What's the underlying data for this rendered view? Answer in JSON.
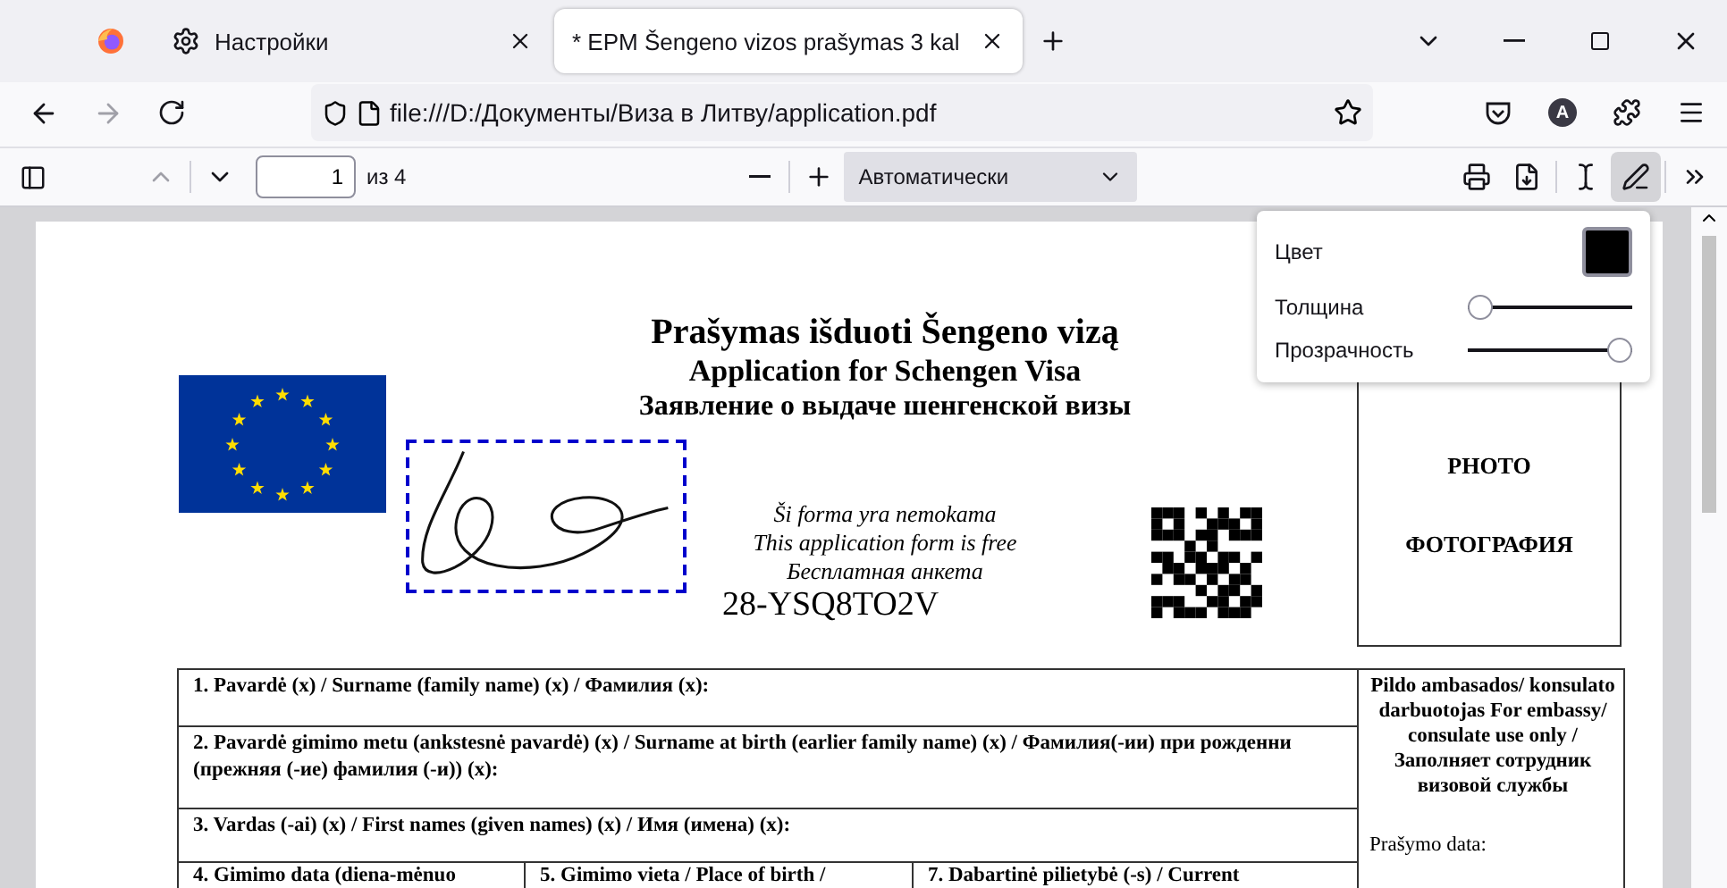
{
  "tabs": [
    {
      "kind": "pinned",
      "selected": false
    },
    {
      "kind": "settings",
      "label": "Настройки",
      "selected": false
    },
    {
      "kind": "document",
      "label": "* EPM Šengeno vizos prašymas 3 kal",
      "selected": true
    }
  ],
  "address_bar": {
    "url": "file:///D:/Документы/Виза в Литву/application.pdf"
  },
  "account": {
    "letter": "A"
  },
  "pdf_toolbar": {
    "page": "1",
    "page_count": "из 4",
    "zoom": "Автоматически",
    "draw_mode": true
  },
  "ink_popup": {
    "color_label": "Цвет",
    "color": "#000000",
    "thickness_label": "Толщина",
    "thickness": {
      "level": 0
    },
    "opacity_label": "Прозрачность",
    "opacity": {
      "level": 1
    }
  },
  "document": {
    "titles": [
      "Prašymas išduoti Šengeno vizą",
      "Application for Schengen Visa",
      "Заявление о выдаче шенгенской визы"
    ],
    "notes": [
      "Ši forma yra nemokama",
      "This application form is free",
      "Бесплатная анкета"
    ],
    "code": "28-YSQ8TO2V",
    "photo_labels": [
      "PHOTO",
      "ФОТОГРАФИЯ"
    ],
    "form_rows": [
      "1. Pavardė (x) / Surname (family name) (x) / Фамилия (x):",
      "2. Pavardė gimimo metu (ankstesnė pavardė) (x) / Surname at birth (earlier family name) (x) / Фамилия(-ии) при рожденни  (прежняя (-ие) фамилия (-и)) (x):",
      "3. Vardas (-ai) (x) / First names (given names) (x) / Имя (имена) (x):"
    ],
    "last_row": [
      "4. Gimimo data (diena-mėnuo",
      "5. Gimimo vieta / Place of birth /",
      "7. Dabartinė pilietybė (-s) / Current"
    ],
    "office_note": "Pildo ambasados/ konsulato darbuotojas For embassy/ consulate use only / Заполняет сотрудник визовой службы",
    "office_date_label": "Prašymo data:"
  }
}
